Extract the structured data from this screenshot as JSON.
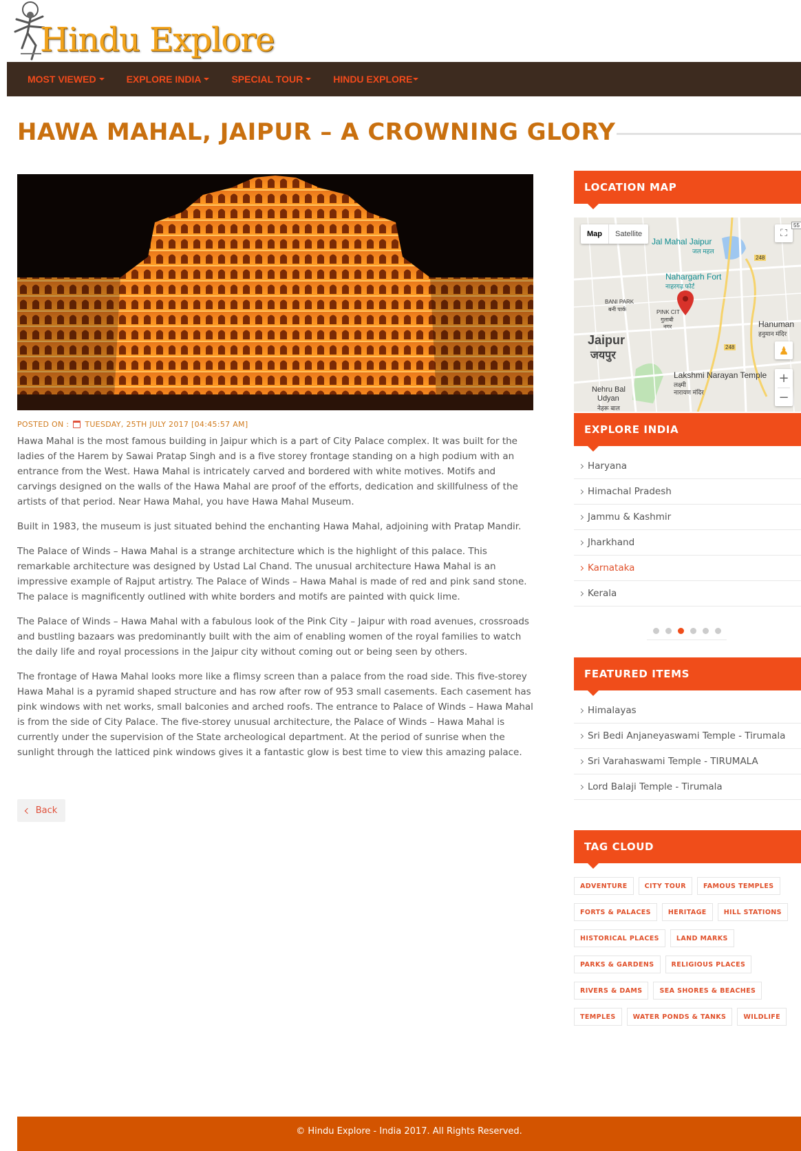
{
  "header": {
    "logo_text": "Hindu Explore",
    "nav": [
      "MOST VIEWED",
      "EXPLORE INDIA",
      "SPECIAL TOUR",
      "HINDU EXPLORE"
    ]
  },
  "article": {
    "title": "HAWA MAHAL, JAIPUR – A CROWNING GLORY",
    "posted_label": "POSTED ON :",
    "posted_date": "TUESDAY, 25TH JULY 2017 [04:45:57 AM]",
    "paragraphs": [
      "Hawa Mahal is the most famous building in Jaipur which is a part of City Palace complex. It was built for the ladies of the Harem by Sawai Pratap Singh and is a five storey frontage standing on a high podium with an entrance from the West. Hawa Mahal is intricately carved and bordered with white motives. Motifs and carvings designed on the walls of the Hawa Mahal are proof of the efforts, dedication and skillfulness of the artists of that period. Near Hawa Mahal, you have Hawa Mahal Museum.",
      "Built in 1983, the museum is just situated behind the enchanting Hawa Mahal, adjoining with Pratap Mandir.",
      "The Palace of Winds – Hawa Mahal is a strange architecture which is the highlight of this palace. This remarkable architecture was designed by Ustad Lal Chand. The unusual architecture Hawa Mahal is an impressive example of Rajput artistry. The Palace of Winds – Hawa Mahal is made of red and pink sand stone. The palace is magnificently outlined with white borders and motifs are painted with quick lime.",
      "The Palace of Winds – Hawa Mahal with a fabulous look of the Pink City – Jaipur with road avenues, crossroads and bustling bazaars was predominantly built with the aim of enabling women of the royal families to watch the daily life and royal processions in the Jaipur city without coming out or being seen by others.",
      "The frontage of Hawa Mahal looks more like a flimsy screen than a palace from the road side. This five-storey Hawa Mahal is a pyramid shaped structure and has row after row of 953 small casements. Each casement has pink windows with net works, small balconies and arched roofs. The entrance to Palace of Winds – Hawa Mahal is from the side of City Palace. The five-storey unusual architecture, the Palace of Winds – Hawa Mahal is currently under the supervision of the State archeological department. At the period of sunrise when the sunlight through the latticed pink windows gives it a fantastic glow is best time to view this amazing palace."
    ],
    "back_label": "Back"
  },
  "sidebar": {
    "location_map_title": "LOCATION MAP",
    "map": {
      "tab_map": "Map",
      "tab_satellite": "Satellite",
      "labels": {
        "jal_mahal": "Jal Mahal Jaipur",
        "jal_mahal_hi": "जल महल",
        "nahargarh": "Nahargarh Fort",
        "nahargarh_hi": "नाहरगढ़ फोर्ट",
        "bani_park": "BANI PARK",
        "bani_park_hi": "बनी पार्क",
        "pink_city": "PINK CIT",
        "pink_city_hi": "गुलाबी",
        "pink_city_hi2": "नगर",
        "hanuman": "Hanuman",
        "hanuman_hi": "हनुमान मंदिर",
        "jaipur": "Jaipur",
        "jaipur_hi": "जयपुर",
        "lakshmi": "Lakshmi Narayan Temple",
        "lakshmi_hi": "लक्ष्मी",
        "lakshmi_hi2": "नारायण मंदिर",
        "nehru": "Nehru Bal",
        "nehru2": "Udyan",
        "nehru_hi": "नेहरू बाल",
        "road_248": "248",
        "road_248b": "248",
        "road_55": "55",
        "zoom_in": "+",
        "zoom_out": "−"
      }
    },
    "explore_title": "EXPLORE INDIA",
    "explore_items": [
      "Haryana",
      "Himachal Pradesh",
      "Jammu & Kashmir",
      "Jharkhand",
      "Karnataka",
      "Kerala"
    ],
    "explore_active_index": 4,
    "carousel_dots": 6,
    "carousel_active_index": 2,
    "featured_title": "FEATURED ITEMS",
    "featured_items": [
      "Himalayas",
      "Sri Bedi Anjaneyaswami Temple - Tirumala",
      "Sri Varahaswami Temple - TIRUMALA",
      "Lord Balaji Temple - Tirumala"
    ],
    "tag_cloud_title": "TAG CLOUD",
    "tags": [
      "ADVENTURE",
      "CITY TOUR",
      "FAMOUS TEMPLES",
      "FORTS & PALACES",
      "HERITAGE",
      "HILL STATIONS",
      "HISTORICAL PLACES",
      "LAND MARKS",
      "PARKS & GARDENS",
      "RELIGIOUS PLACES",
      "RIVERS & DAMS",
      "SEA SHORES & BEACHES",
      "TEMPLES",
      "WATER PONDS & TANKS",
      "WILDLIFE"
    ]
  },
  "footer": {
    "text": "© Hindu Explore - India 2017. All Rights Reserved."
  },
  "colors": {
    "nav_bg": "#3d2b1f",
    "accent": "#f04d1a",
    "title": "#c9700f",
    "footer_bg": "#d35400"
  }
}
